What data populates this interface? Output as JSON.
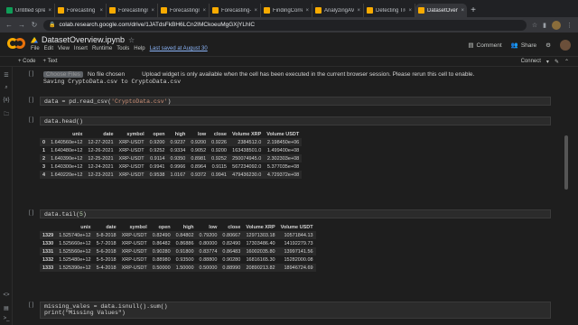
{
  "browser": {
    "tabs": [
      {
        "label": "Untitled spre",
        "color": "#0f9d58",
        "active": false
      },
      {
        "label": "Forecasting C",
        "color": "#f9ab00",
        "active": false
      },
      {
        "label": "Forecastingm",
        "color": "#f9ab00",
        "active": false
      },
      {
        "label": "Forecastingm",
        "color": "#f9ab00",
        "active": false
      },
      {
        "label": "Forecasting-",
        "color": "#f9ab00",
        "active": false
      },
      {
        "label": "FindingCorre",
        "color": "#f9ab00",
        "active": false
      },
      {
        "label": "AnalyzingAVa",
        "color": "#f9ab00",
        "active": false
      },
      {
        "label": "Detecting Tre",
        "color": "#f9ab00",
        "active": false
      },
      {
        "label": "DatasetOvervi",
        "color": "#f9ab00",
        "active": true
      }
    ],
    "url": "colab.research.google.com/drive/1JATdsFkBH6LCn2IMCkoeuMgGXjYLhIC"
  },
  "header": {
    "notebook_name": "DatasetOverview.ipynb",
    "menus": [
      "File",
      "Edit",
      "View",
      "Insert",
      "Runtime",
      "Tools",
      "Help"
    ],
    "last_saved": "Last saved at August 30",
    "comment_label": "Comment",
    "share_label": "Share"
  },
  "toolbar": {
    "code_label": "+ Code",
    "text_label": "+ Text",
    "connect_label": "Connect"
  },
  "cells": {
    "upload": {
      "run_label": "[ ]",
      "choose_label": "Choose Files",
      "no_file": "No file chosen",
      "message": "Upload widget is only available when the cell has been executed in the current browser session. Please rerun this cell to enable.",
      "saving": "Saving CryptoData.csv to CryptoData.csv"
    },
    "read_csv": {
      "run_label": "[ ]",
      "code_prefix": "data = pd.read_csv(",
      "code_string": "'CryptoData.csv'",
      "code_suffix": ")"
    },
    "head": {
      "run_label": "[ ]",
      "code": "data.head()"
    },
    "tail": {
      "run_label": "[ ]",
      "code_prefix": "data.tail(",
      "code_num": "5",
      "code_suffix": ")"
    },
    "missing": {
      "run_label": "[ ]",
      "line1": "missing_vales = data.isnull().sum()",
      "line2": "print(\"Missing Values\")"
    }
  },
  "head_table": {
    "columns": [
      "",
      "unix",
      "date",
      "symbol",
      "open",
      "high",
      "low",
      "close",
      "Volume XRP",
      "Volume USDT"
    ],
    "rows": [
      [
        "0",
        "1.640560e+12",
        "12-27-2021",
        "XRP-USDT",
        "0.9200",
        "0.9237",
        "0.9200",
        "0.9226",
        "2384512.0",
        "2.198450e+06"
      ],
      [
        "1",
        "1.640480e+12",
        "12-26-2021",
        "XRP-USDT",
        "0.9252",
        "0.9334",
        "0.9052",
        "0.9200",
        "163438501.0",
        "1.499400e+08"
      ],
      [
        "2",
        "1.640390e+12",
        "12-25-2021",
        "XRP-USDT",
        "0.9114",
        "0.9350",
        "0.8981",
        "0.9252",
        "250074945.0",
        "2.302303e+08"
      ],
      [
        "3",
        "1.640300e+12",
        "12-24-2021",
        "XRP-USDT",
        "0.9941",
        "0.9966",
        "0.8964",
        "0.9115",
        "567234092.0",
        "5.377035e+08"
      ],
      [
        "4",
        "1.640220e+12",
        "12-23-2021",
        "XRP-USDT",
        "0.9538",
        "1.0167",
        "0.9372",
        "0.9941",
        "479436230.0",
        "4.729372e+08"
      ]
    ]
  },
  "tail_table": {
    "columns": [
      "",
      "unix",
      "date",
      "symbol",
      "open",
      "high",
      "low",
      "close",
      "Volume XRP",
      "Volume USDT"
    ],
    "rows": [
      [
        "1329",
        "1.525740e+12",
        "5-8-2018",
        "XRP-USDT",
        "0.82490",
        "0.84802",
        "0.79200",
        "0.80667",
        "12971303.18",
        "10571844.13"
      ],
      [
        "1330",
        "1.525660e+12",
        "5-7-2018",
        "XRP-USDT",
        "0.86482",
        "0.86886",
        "0.80000",
        "0.82490",
        "17303486.40",
        "14192279.73"
      ],
      [
        "1331",
        "1.525560e+12",
        "5-6-2018",
        "XRP-USDT",
        "0.90280",
        "0.91800",
        "0.83774",
        "0.86483",
        "16002035.80",
        "13997141.56"
      ],
      [
        "1332",
        "1.525480e+12",
        "5-5-2018",
        "XRP-USDT",
        "0.88980",
        "0.93500",
        "0.88800",
        "0.90280",
        "16816165.30",
        "15282000.08"
      ],
      [
        "1333",
        "1.525390e+12",
        "5-4-2018",
        "XRP-USDT",
        "0.50000",
        "1.50000",
        "0.50000",
        "0.88990",
        "20890213.82",
        "18946724.69"
      ]
    ]
  }
}
